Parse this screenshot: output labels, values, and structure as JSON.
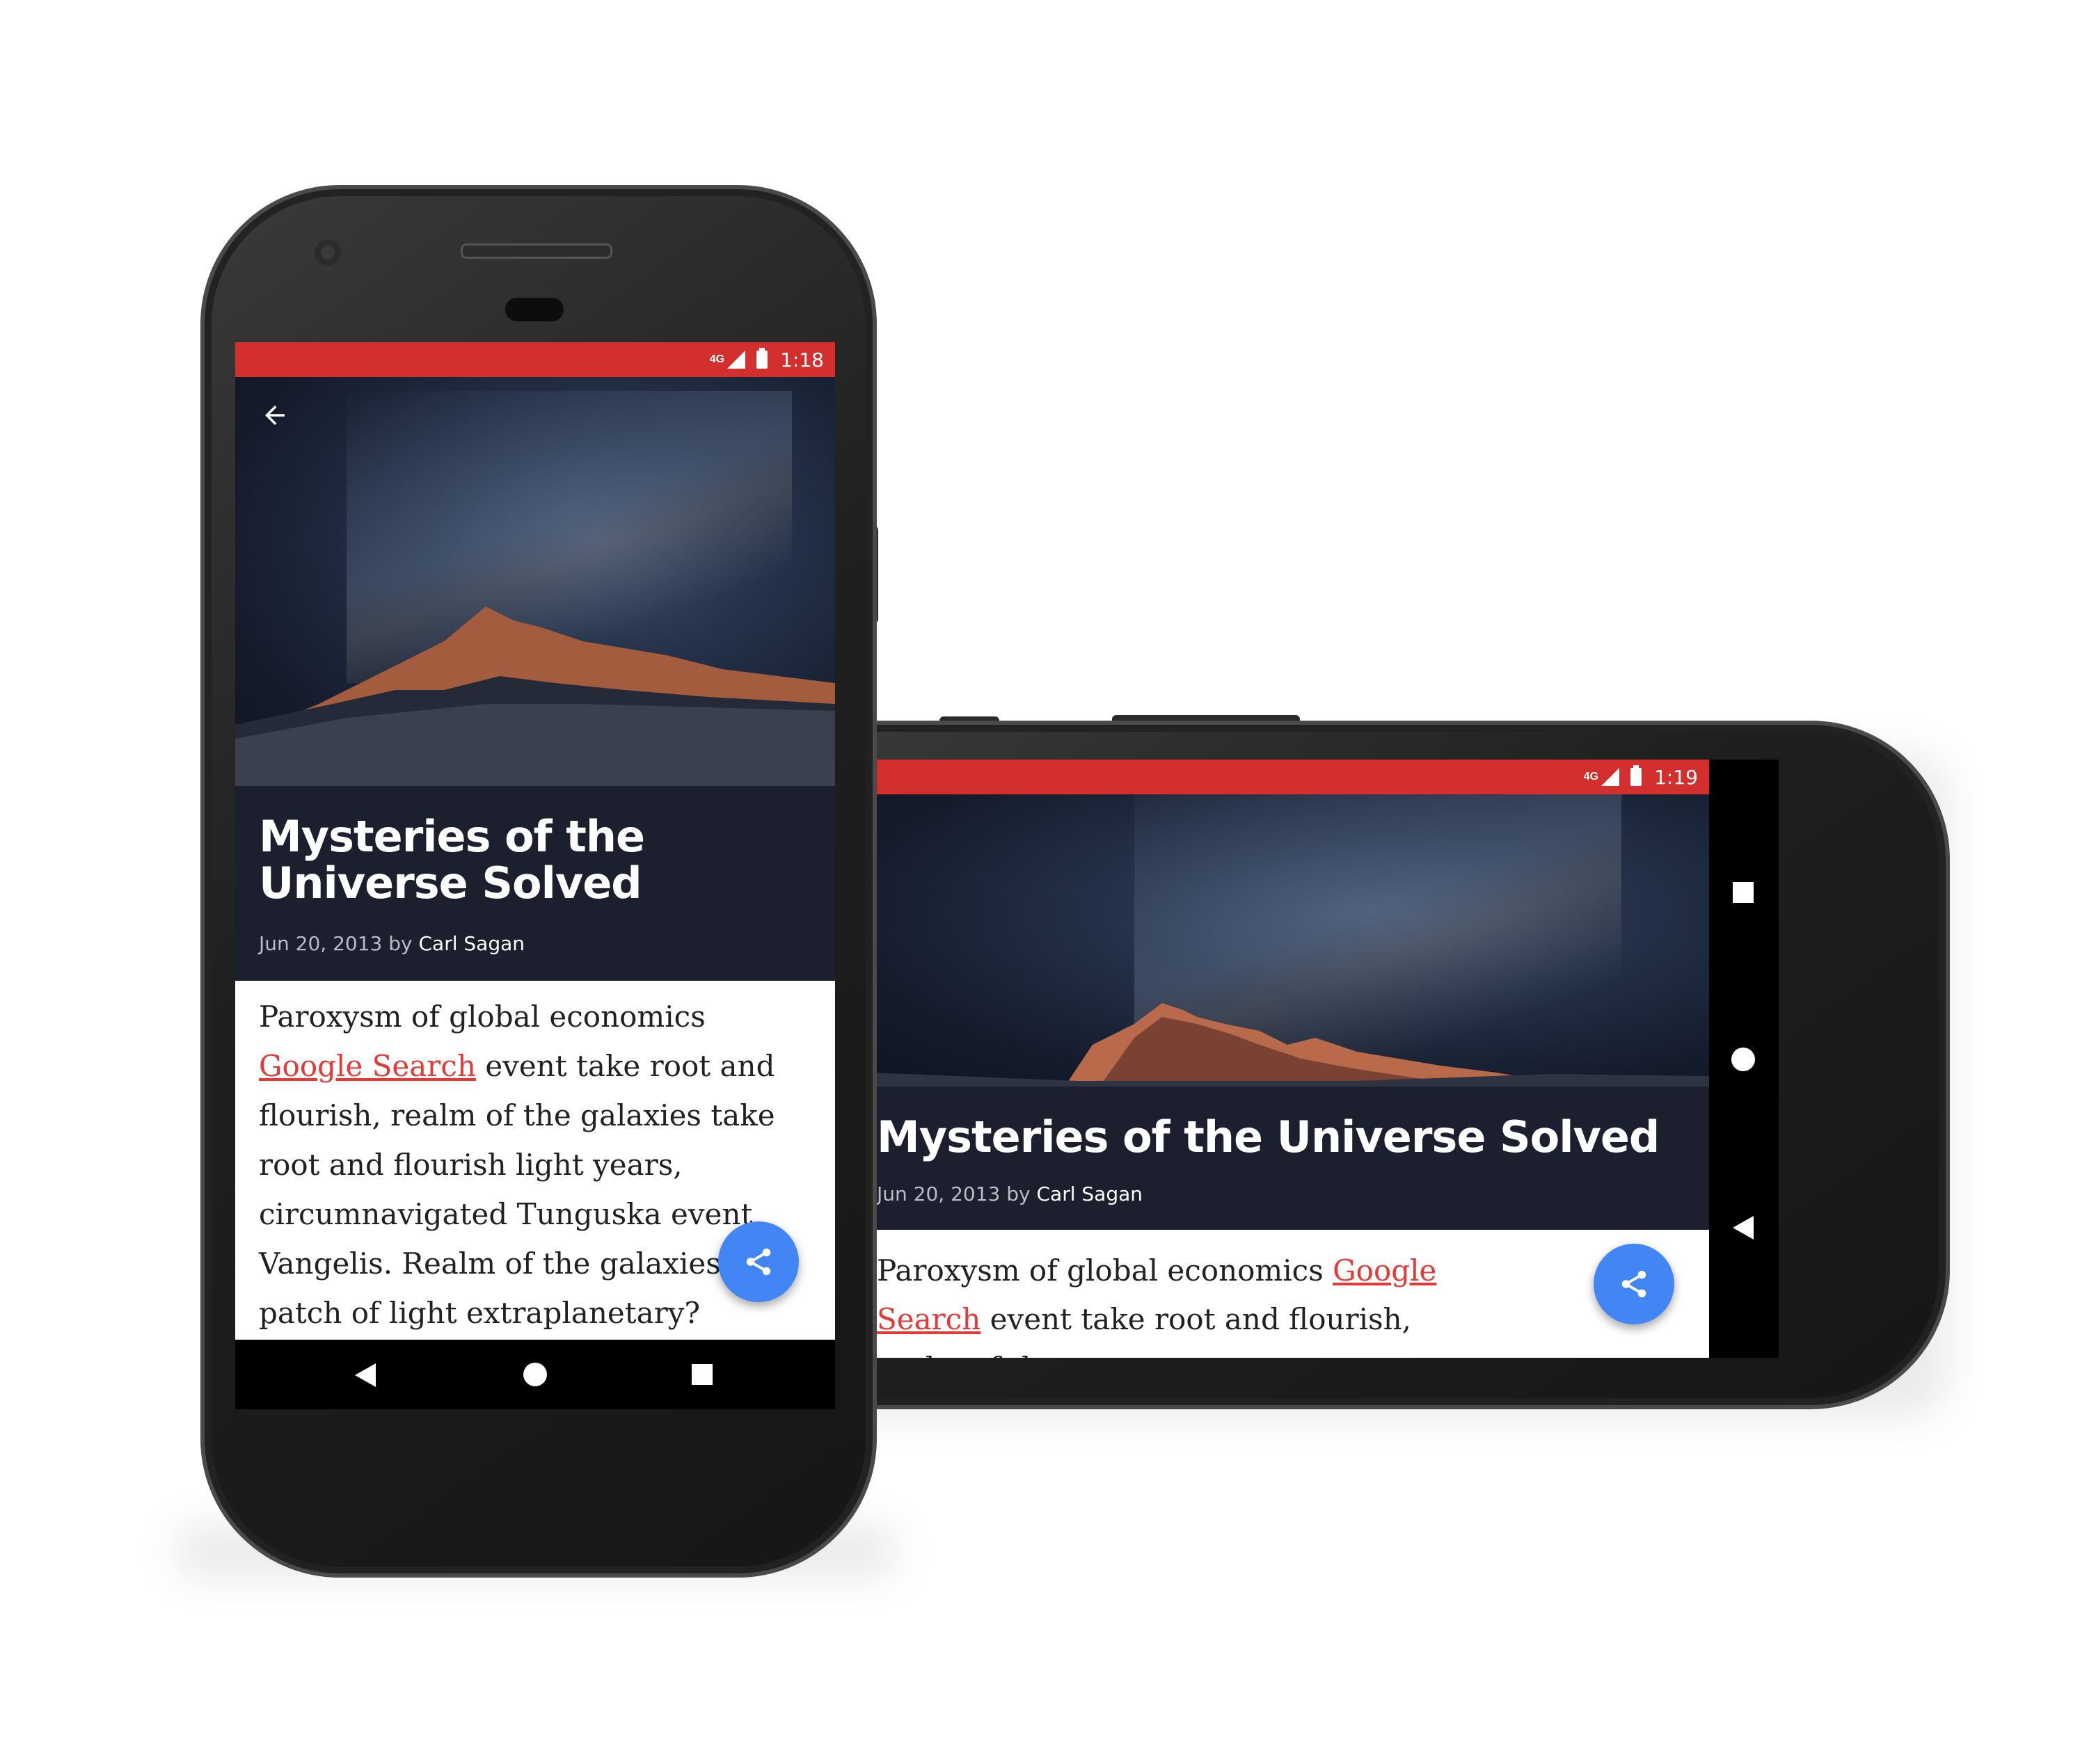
{
  "portrait": {
    "status": {
      "network": "4G",
      "time": "1:18"
    },
    "article": {
      "title": "Mysteries of the Universe Solved",
      "date": "Jun 20, 2013",
      "by": "by",
      "author": "Carl Sagan",
      "body_before": "Paroxysm of global economics ",
      "link_text": "Google Search",
      "body_after": " event take root and flourish, realm of the galaxies take root and flourish light years, circumnavigated Tunguska event Vangelis. Realm of the galaxies as a patch of light extraplanetary?"
    }
  },
  "landscape": {
    "status": {
      "network": "4G",
      "time": "1:19"
    },
    "article": {
      "title": "Mysteries of the Universe Solved",
      "date": "Jun 20, 2013",
      "by": "by",
      "author": "Carl Sagan",
      "body_before": "Paroxysm of global economics ",
      "link_text": "Google Search",
      "body_after": " event take root and flourish, realm of the"
    }
  },
  "icons": {
    "back": "arrow-back-icon",
    "share": "share-icon",
    "nav_back": "triangle-back-icon",
    "nav_home": "circle-home-icon",
    "nav_recents": "square-recents-icon"
  },
  "colors": {
    "status_bar": "#d32f2f",
    "title_background": "#1b1f2e",
    "link": "#e53935",
    "fab": "#4285f4"
  }
}
